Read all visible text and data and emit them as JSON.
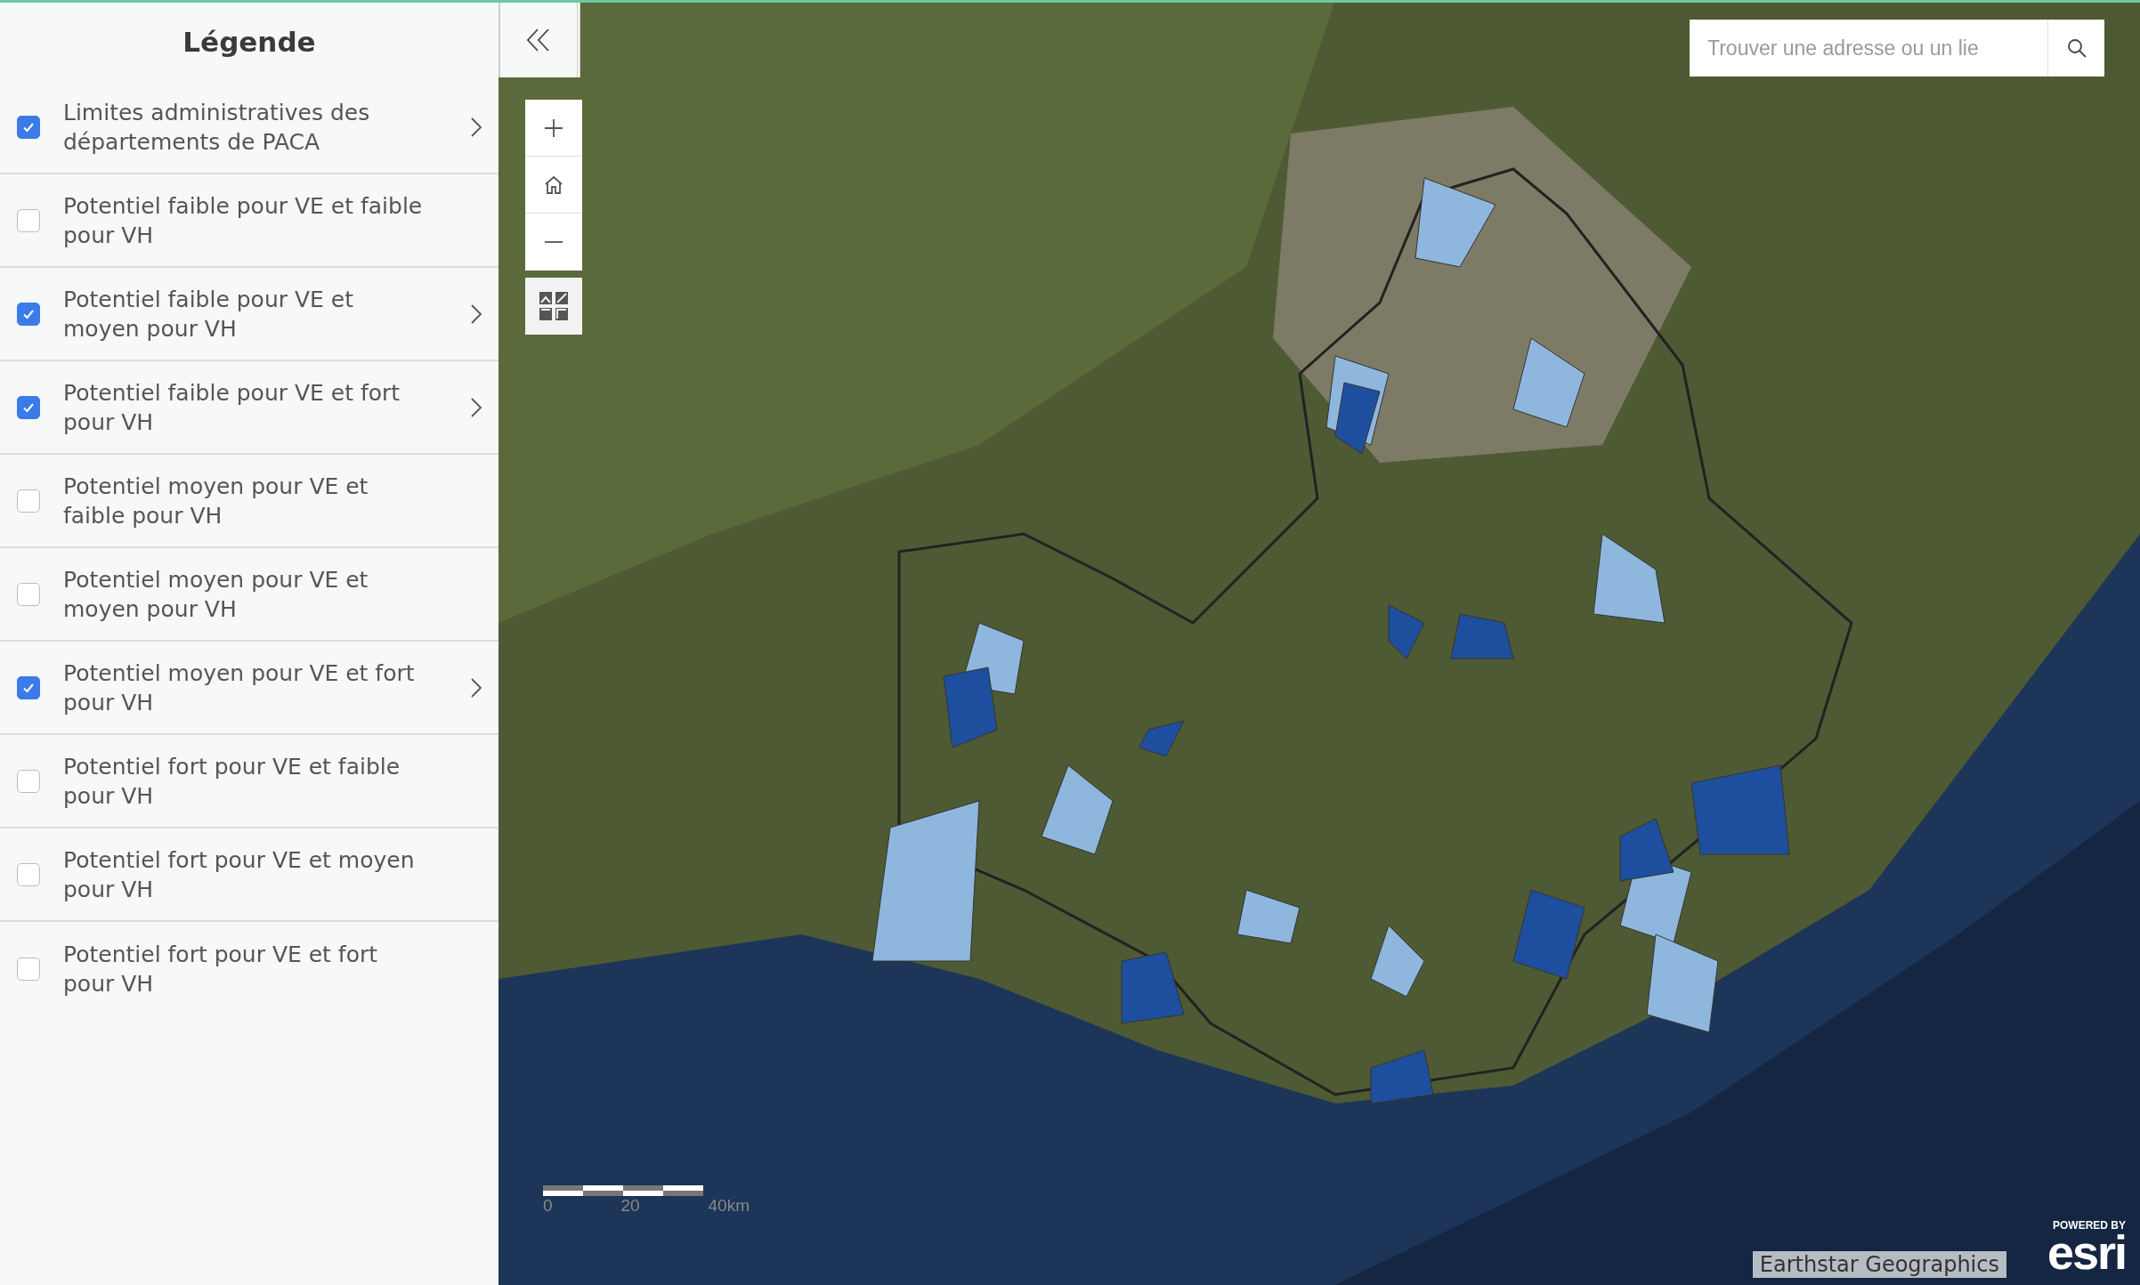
{
  "legend": {
    "title": "Légende",
    "layers": [
      {
        "label": "Limites administratives des départements de PACA",
        "checked": true
      },
      {
        "label": "Potentiel faible pour VE et faible pour VH",
        "checked": false
      },
      {
        "label": "Potentiel faible pour VE et moyen pour VH",
        "checked": true
      },
      {
        "label": "Potentiel faible pour VE et fort pour VH",
        "checked": true
      },
      {
        "label": "Potentiel moyen pour VE et faible pour VH",
        "checked": false
      },
      {
        "label": "Potentiel moyen pour VE et moyen pour VH",
        "checked": false
      },
      {
        "label": "Potentiel moyen pour VE et fort pour VH",
        "checked": true
      },
      {
        "label": "Potentiel fort pour VE et faible pour VH",
        "checked": false
      },
      {
        "label": "Potentiel fort pour VE et moyen pour VH",
        "checked": false
      },
      {
        "label": "Potentiel fort pour VE et fort pour VH",
        "checked": false
      }
    ]
  },
  "map": {
    "search": {
      "placeholder": "Trouver une adresse ou un lie"
    },
    "scale_bar": {
      "labels": [
        "0",
        "20",
        "40km"
      ]
    },
    "attribution": "Earthstar Geographics",
    "logo": {
      "caption": "POWERED BY",
      "wordmark": "esri"
    }
  }
}
